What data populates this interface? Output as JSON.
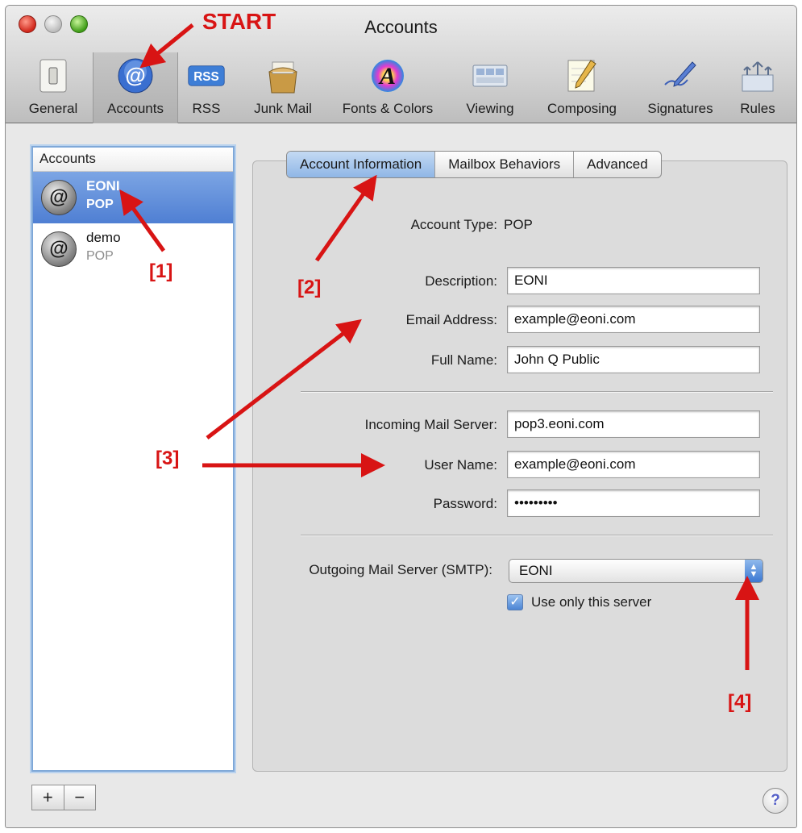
{
  "window": {
    "title": "Accounts"
  },
  "toolbar": {
    "items": [
      {
        "label": "General",
        "icon": "light-switch-icon"
      },
      {
        "label": "Accounts",
        "icon": "at-sign-icon",
        "glyph": "@"
      },
      {
        "label": "RSS",
        "icon": "rss-icon",
        "glyph": "RSS"
      },
      {
        "label": "Junk Mail",
        "icon": "junk-mail-icon"
      },
      {
        "label": "Fonts & Colors",
        "icon": "fonts-colors-icon",
        "glyph": "A"
      },
      {
        "label": "Viewing",
        "icon": "viewing-icon"
      },
      {
        "label": "Composing",
        "icon": "composing-icon"
      },
      {
        "label": "Signatures",
        "icon": "signatures-icon"
      },
      {
        "label": "Rules",
        "icon": "rules-icon"
      }
    ],
    "selected": "Accounts"
  },
  "accounts": {
    "header": "Accounts",
    "items": [
      {
        "name": "EONI",
        "type": "POP",
        "selected": true
      },
      {
        "name": "demo",
        "type": "POP",
        "selected": false
      }
    ],
    "add_label": "+",
    "remove_label": "−"
  },
  "tabs": [
    {
      "label": "Account Information",
      "active": true
    },
    {
      "label": "Mailbox Behaviors",
      "active": false
    },
    {
      "label": "Advanced",
      "active": false
    }
  ],
  "form": {
    "account_type_label": "Account Type:",
    "account_type_value": "POP",
    "description_label": "Description:",
    "description_value": "EONI",
    "email_label": "Email Address:",
    "email_value": "example@eoni.com",
    "full_name_label": "Full Name:",
    "full_name_value": "John Q Public",
    "incoming_label": "Incoming Mail Server:",
    "incoming_value": "pop3.eoni.com",
    "username_label": "User Name:",
    "username_value": "example@eoni.com",
    "password_label": "Password:",
    "password_value": "•••••••••",
    "smtp_label": "Outgoing Mail Server (SMTP):",
    "smtp_value": "EONI",
    "use_only_label": "Use only this server",
    "use_only_checked": true
  },
  "help": {
    "glyph": "?"
  },
  "annotations": {
    "start": "START",
    "step1": "[1]",
    "step2": "[2]",
    "step3": "[3]",
    "step4": "[4]",
    "color": "#d81414"
  }
}
